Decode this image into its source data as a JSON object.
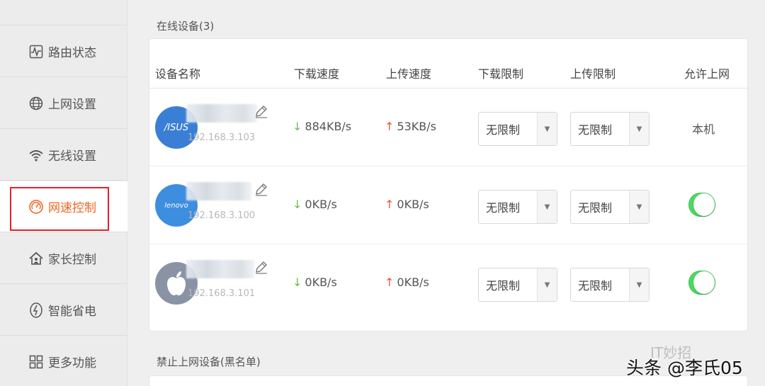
{
  "sidebar": {
    "items": [
      {
        "label": "路由状态",
        "icon": "pulse-icon"
      },
      {
        "label": "上网设置",
        "icon": "globe-icon"
      },
      {
        "label": "无线设置",
        "icon": "wifi-icon"
      },
      {
        "label": "网速控制",
        "icon": "speed-gauge-icon",
        "active": true
      },
      {
        "label": "家长控制",
        "icon": "house-icon"
      },
      {
        "label": "智能省电",
        "icon": "power-save-icon"
      },
      {
        "label": "更多功能",
        "icon": "grid-icon"
      }
    ]
  },
  "online": {
    "title": "在线设备(3)",
    "headers": {
      "name": "设备名称",
      "download": "下载速度",
      "upload": "上传速度",
      "down_limit": "下载限制",
      "up_limit": "上传限制",
      "allow": "允许上网"
    },
    "rows": [
      {
        "brand": "asus",
        "brand_text": "/ISUS",
        "ip": "192.168.3.103",
        "down": "884KB/s",
        "up": "53KB/s",
        "down_limit": "无限制",
        "up_limit": "无限制",
        "allow_text": "本机",
        "allowed": true
      },
      {
        "brand": "lenovo",
        "brand_text": "lenovo",
        "ip": "192.168.3.100",
        "down": "0KB/s",
        "up": "0KB/s",
        "down_limit": "无限制",
        "up_limit": "无限制",
        "allowed": true
      },
      {
        "brand": "apple",
        "brand_text": "",
        "ip": "192.168.3.101",
        "down": "0KB/s",
        "up": "0KB/s",
        "down_limit": "无限制",
        "up_limit": "无限制",
        "allowed": true
      }
    ]
  },
  "blacklist": {
    "title": "禁止上网设备(黑名单)"
  },
  "watermark": {
    "line1": "IT妙招",
    "line2": "头条 @李氏05"
  },
  "colors": {
    "accent": "#f26522",
    "toggle_on": "#4cd964",
    "highlight_box": "#e0232a"
  }
}
